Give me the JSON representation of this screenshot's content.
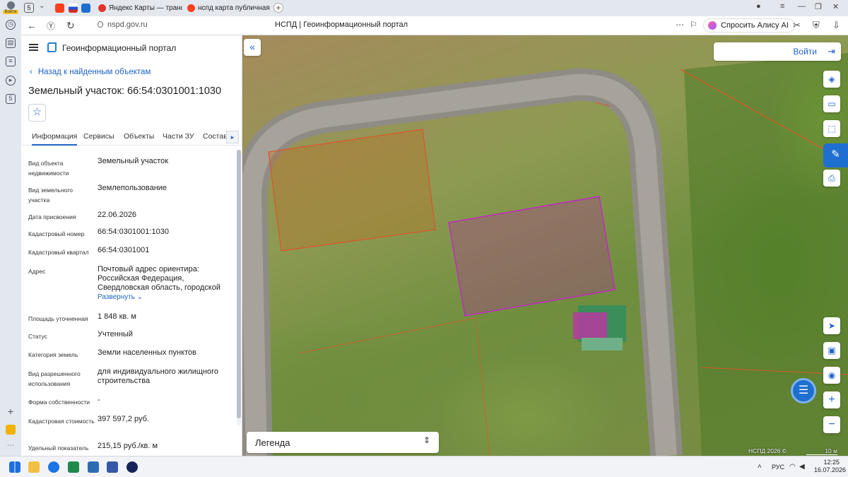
{
  "browser": {
    "profile_label": "Войти",
    "tab_count": "5",
    "tabs": [
      {
        "title": "Яндекс Карты — транспорт",
        "active": false
      },
      {
        "title": "нспд карта публичная ка",
        "active": false
      }
    ],
    "url": "nspd.gov.ru",
    "page_title": "НСПД | Геоинформационный портал",
    "alisa_label": "Спросить Алису AI"
  },
  "panel": {
    "portal_name": "Геоинформационный портал",
    "back_label": "Назад к найденным объектам",
    "object_title": "Земельный участок: 66:54:0301001:1030",
    "tabs": [
      "Информация",
      "Сервисы",
      "Объекты",
      "Части ЗУ",
      "Состав"
    ],
    "rows": [
      {
        "label": "Вид объекта недвижимости",
        "value": "Земельный участок"
      },
      {
        "label": "Вид земельного участка",
        "value": "Землепользование"
      },
      {
        "label": "Дата присвоения",
        "value": "22.06.2026"
      },
      {
        "label": "Кадастровый номер",
        "value": "66:54:0301001:1030"
      },
      {
        "label": "Кадастровый квартал",
        "value": "66:54:0301001"
      },
      {
        "label": "Адрес",
        "value": "Почтовый адрес ориентира: Российская Федерация, Свердловская область, городской",
        "expand": "Развернуть"
      },
      {
        "label": "Площадь уточненная",
        "value": "1 848 кв. м"
      },
      {
        "label": "Статус",
        "value": "Учтенный"
      },
      {
        "label": "Категория земель",
        "value": "Земли населенных пунктов"
      },
      {
        "label": "Вид разрешенного использования",
        "value": "для индивидуального жилищного строительства"
      },
      {
        "label": "Форма собственности",
        "value": "-"
      },
      {
        "label": "Кадастровая стоимость",
        "value": "397 597,2 руб."
      },
      {
        "label": "Удельный показатель кадастровой",
        "value": "215,15 руб./кв. м"
      }
    ]
  },
  "map": {
    "login_label": "Войти",
    "legend_label": "Легенда",
    "copyright": "НСПД 2026 ©",
    "scale_label": "10 м"
  },
  "taskbar": {
    "lang": "РУС",
    "time": "12:25",
    "date": "16.07.2026"
  },
  "colors": {
    "accent": "#1f63c9",
    "selected_parcel": "#c02ac0",
    "parcel_outline": "#d9582a"
  }
}
